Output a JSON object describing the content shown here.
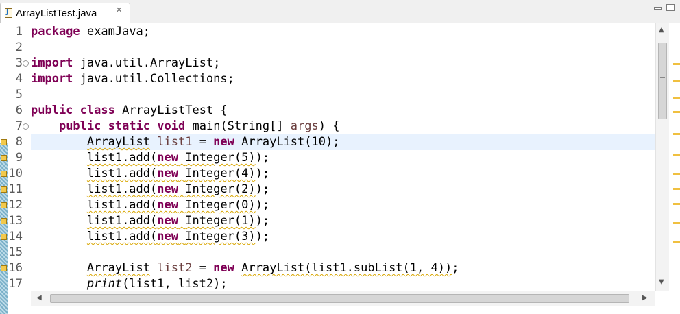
{
  "tab": {
    "title": "ArrayListTest.java",
    "close": "✕",
    "icon": "J"
  },
  "window_controls": {
    "minimize": "",
    "maximize": ""
  },
  "editor": {
    "lines": [
      {
        "n": "1"
      },
      {
        "n": "2"
      },
      {
        "n": "3"
      },
      {
        "n": "4"
      },
      {
        "n": "5"
      },
      {
        "n": "6"
      },
      {
        "n": "7"
      },
      {
        "n": "8"
      },
      {
        "n": "9"
      },
      {
        "n": "10"
      },
      {
        "n": "11"
      },
      {
        "n": "12"
      },
      {
        "n": "13"
      },
      {
        "n": "14"
      },
      {
        "n": "15"
      },
      {
        "n": "16"
      },
      {
        "n": "17"
      }
    ],
    "tokens": {
      "package": "package",
      "pkg_name": "examJava;",
      "import1": "import",
      "import1_target": "java.util.ArrayList;",
      "import2": "import",
      "import2_target": "java.util.Collections;",
      "public": "public",
      "class": "class",
      "class_name": "ArrayListTest {",
      "public2": "public",
      "static": "static",
      "void": "void",
      "main_sig": "main(String[] ",
      "args": "args",
      "main_close": ") {",
      "arraylist_type": "ArrayList",
      "list1": "list1",
      "assign": " = ",
      "new": "new",
      "ctor10": "ArrayList(10);",
      "add_5": "list1.add(",
      "new_5": "new",
      "int_5": "Integer(5)",
      "close_5": ");",
      "add_4": "list1.add(",
      "new_4": "new",
      "int_4": "Integer(4)",
      "close_4": ");",
      "add_2": "list1.add(",
      "new_2": "new",
      "int_2": "Integer(2)",
      "close_2": ");",
      "add_0": "list1.add(",
      "new_0": "new",
      "int_0": "Integer(0)",
      "close_0": ");",
      "add_1": "list1.add(",
      "new_1": "new",
      "int_1": "Integer(1)",
      "close_1": ");",
      "add_3": "list1.add(",
      "new_3": "new",
      "int_3": "Integer(3)",
      "close_3": ");",
      "arraylist_type2": "ArrayList",
      "list2": "list2",
      "assign2": " = ",
      "new_l2": "new",
      "ctor_sub": "ArrayList(list1.subList(1, 4))",
      "close_sub": ";",
      "print": "print",
      "print_args": "(list1, list2);"
    }
  },
  "colors": {
    "keyword": "#7f0055",
    "current_line": "#e8f2fe",
    "warning": "#d8a500"
  }
}
